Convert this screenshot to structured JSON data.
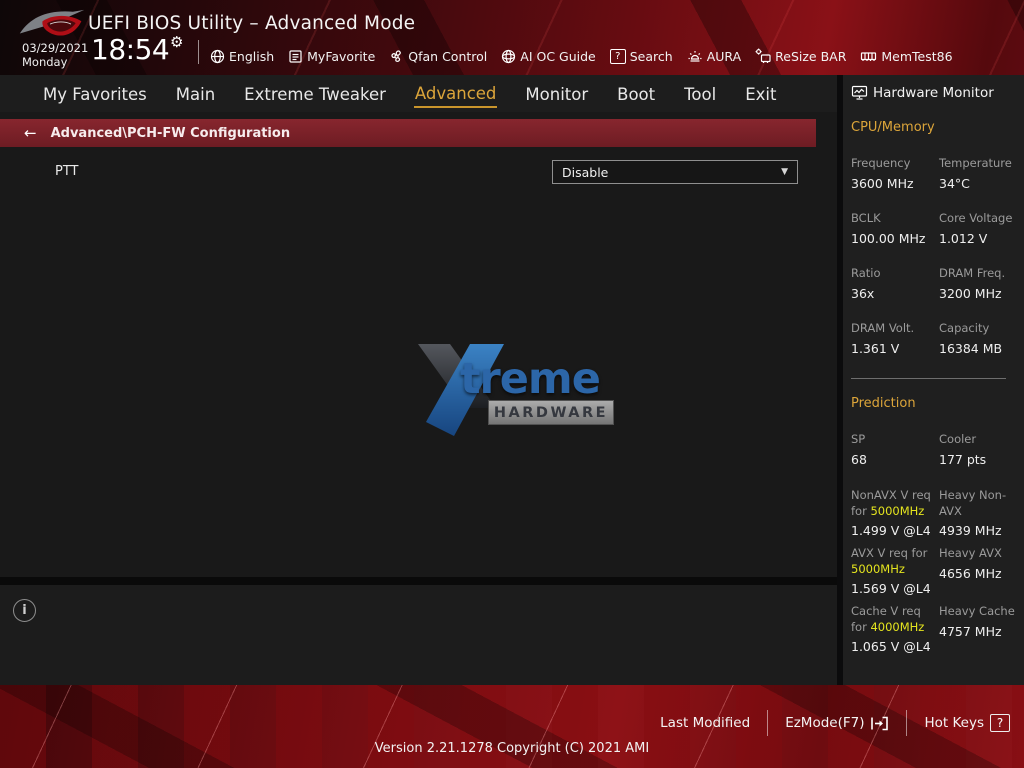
{
  "app": {
    "title": "UEFI BIOS Utility – Advanced Mode",
    "date": "03/29/2021",
    "day": "Monday",
    "time": "18:54"
  },
  "toolbar": {
    "items": [
      {
        "label": "English",
        "icon": "globe-icon"
      },
      {
        "label": "MyFavorite",
        "icon": "favorites-list-icon"
      },
      {
        "label": "Qfan Control",
        "icon": "fan-icon"
      },
      {
        "label": "AI OC Guide",
        "icon": "ai-sphere-icon"
      },
      {
        "label": "Search",
        "icon": "question-box-icon"
      },
      {
        "label": "AURA",
        "icon": "aura-lamp-icon"
      },
      {
        "label": "ReSize BAR",
        "icon": "resize-bar-icon"
      },
      {
        "label": "MemTest86",
        "icon": "memory-icon"
      }
    ]
  },
  "nav": {
    "tabs": [
      {
        "label": "My Favorites",
        "active": false
      },
      {
        "label": "Main",
        "active": false
      },
      {
        "label": "Extreme Tweaker",
        "active": false
      },
      {
        "label": "Advanced",
        "active": true
      },
      {
        "label": "Monitor",
        "active": false
      },
      {
        "label": "Boot",
        "active": false
      },
      {
        "label": "Tool",
        "active": false
      },
      {
        "label": "Exit",
        "active": false
      }
    ]
  },
  "breadcrumb": {
    "back_icon": "back-arrow-icon",
    "text": "Advanced\\PCH-FW Configuration"
  },
  "settings": {
    "ptt": {
      "label": "PTT",
      "value": "Disable"
    }
  },
  "watermark": {
    "treme": "treme",
    "hardware": "HARDWARE"
  },
  "sidebar": {
    "title": "Hardware Monitor",
    "cpu": {
      "heading": "CPU/Memory",
      "cells": [
        {
          "label": "Frequency",
          "value": "3600 MHz"
        },
        {
          "label": "Temperature",
          "value": "34°C"
        },
        {
          "label": "BCLK",
          "value": "100.00 MHz"
        },
        {
          "label": "Core Voltage",
          "value": "1.012 V"
        },
        {
          "label": "Ratio",
          "value": "36x"
        },
        {
          "label": "DRAM Freq.",
          "value": "3200 MHz"
        },
        {
          "label": "DRAM Volt.",
          "value": "1.361 V"
        },
        {
          "label": "Capacity",
          "value": "16384 MB"
        }
      ]
    },
    "prediction": {
      "heading": "Prediction",
      "cells": [
        {
          "label": "SP",
          "value": "68"
        },
        {
          "label": "Cooler",
          "value": "177 pts"
        }
      ],
      "rows": [
        {
          "left_prefix": "NonAVX V req for ",
          "left_highlight": "5000MHz",
          "left_value": "1.499 V @L4",
          "right_label": "Heavy Non-AVX",
          "right_value": "4939 MHz"
        },
        {
          "left_prefix": "AVX V req for ",
          "left_highlight": "5000MHz",
          "left_value": "1.569 V @L4",
          "right_label": "Heavy AVX",
          "right_value": "4656 MHz"
        },
        {
          "left_prefix": "Cache V req for ",
          "left_highlight": "4000MHz",
          "left_value": "1.065 V @L4",
          "right_label": "Heavy Cache",
          "right_value": "4757 MHz"
        }
      ]
    }
  },
  "footer": {
    "actions": [
      {
        "label": "Last Modified"
      },
      {
        "label": "EzMode(F7)",
        "icon": "ezmode-enter-icon"
      },
      {
        "label": "Hot Keys",
        "icon": "question-box-icon",
        "icon_text": "?"
      }
    ],
    "search_icon_text": "?",
    "version": "Version 2.21.1278 Copyright (C) 2021 AMI"
  },
  "colors": {
    "accent_gold": "#dca53a",
    "highlight_yellow": "#e4e41f",
    "breadcrumb_red": "#771f26",
    "rog_red": "#b00e16",
    "panel_dark": "#191919"
  }
}
